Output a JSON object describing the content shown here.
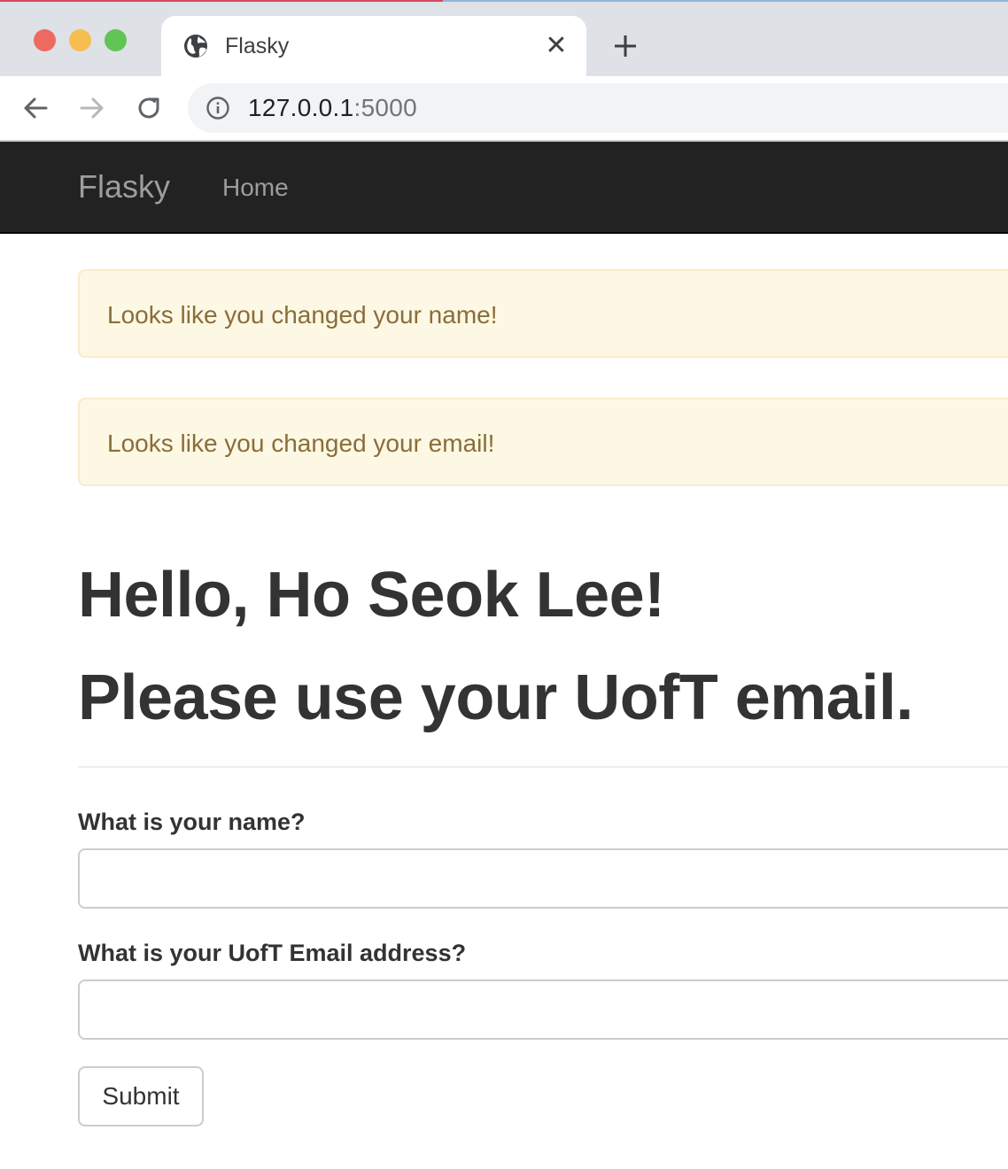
{
  "browser": {
    "tab_title": "Flasky",
    "url_host": "127.0.0.1",
    "url_port": ":5000",
    "icons": {
      "close": "close-icon",
      "new_tab": "plus-icon",
      "back": "arrow-left-icon",
      "forward": "arrow-right-icon",
      "reload": "reload-icon",
      "site_info": "info-icon",
      "favicon": "globe-icon"
    }
  },
  "navbar": {
    "brand": "Flasky",
    "home": "Home"
  },
  "flash_messages": [
    "Looks like you changed your name!",
    "Looks like you changed your email!"
  ],
  "page": {
    "greeting": "Hello, Ho Seok Lee!",
    "notice": "Please use your UofT email."
  },
  "form": {
    "name_label": "What is your name?",
    "name_value": "",
    "email_label": "What is your UofT Email address?",
    "email_value": "",
    "submit_label": "Submit"
  },
  "colors": {
    "navbar_bg": "#222222",
    "alert_bg": "#fcf8e3",
    "alert_text": "#8a6d3b"
  }
}
